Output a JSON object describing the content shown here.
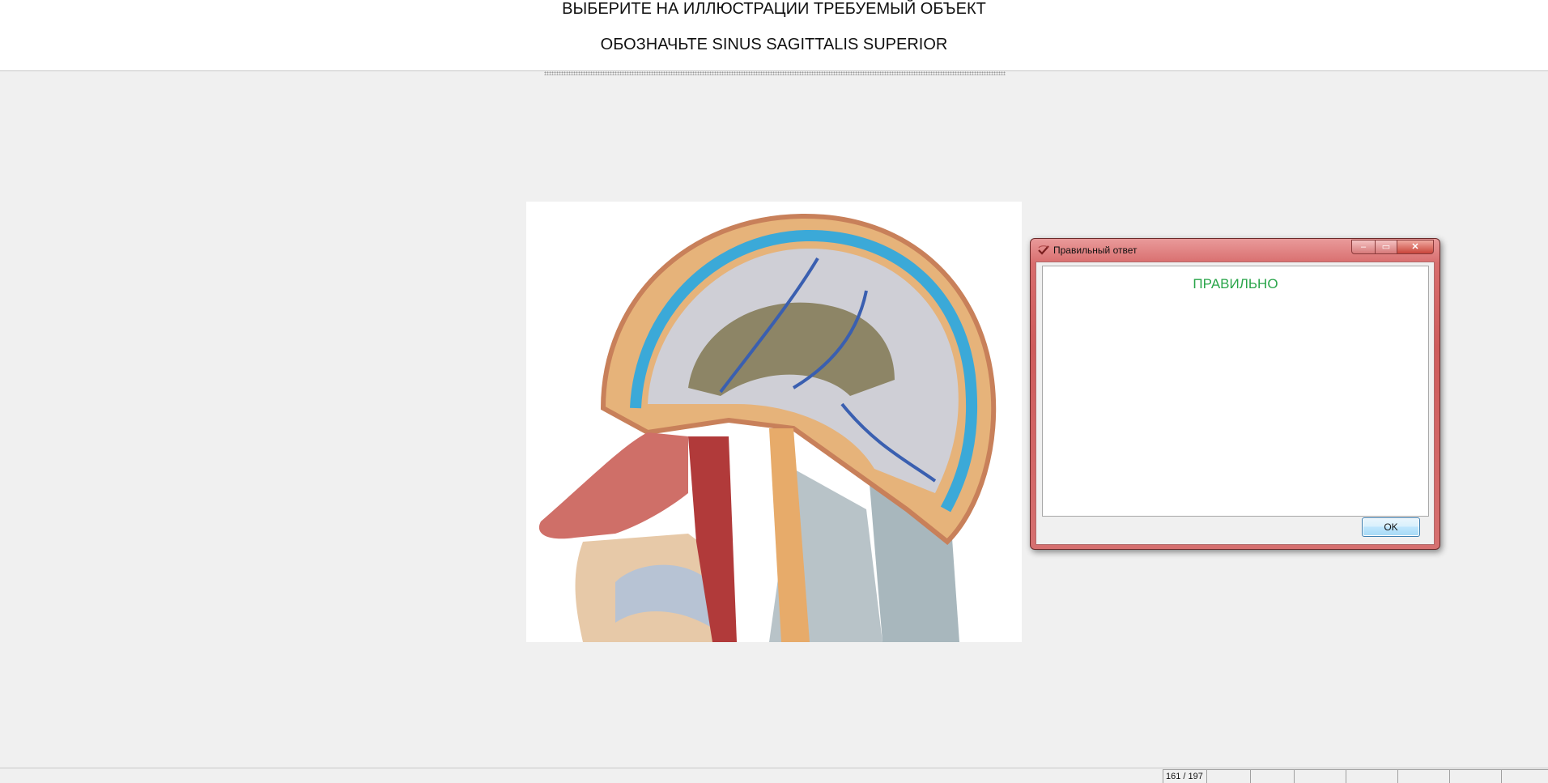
{
  "header": {
    "instruction": "ВЫБЕРИТЕ НА ИЛЛЮСТРАЦИИ ТРЕБУЕМЫЙ ОБЪЕКТ",
    "task": "ОБОЗНАЧЬТЕ SINUS SAGITTALIS SUPERIOR"
  },
  "illustration": {
    "subject": "head-sagittal-section-anatomy"
  },
  "dialog": {
    "title": "Правильный ответ",
    "answer": "ПРАВИЛЬНО",
    "ok_label": "OK",
    "answer_color": "#2aa54a",
    "title_bar_color": "#cf5c5c"
  },
  "statusbar": {
    "counter": "161 / 197"
  }
}
